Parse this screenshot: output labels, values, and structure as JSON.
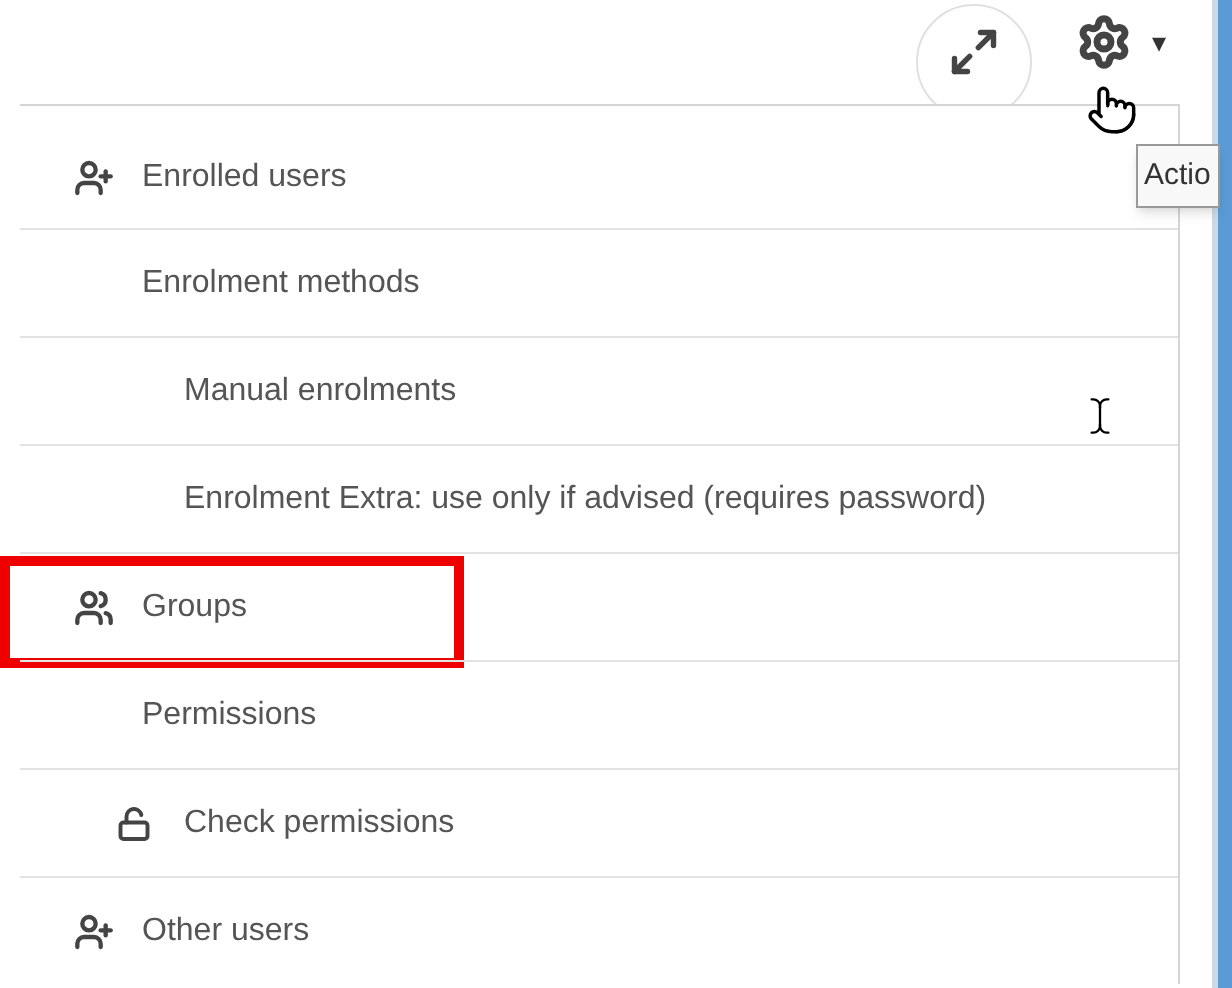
{
  "toolbar": {
    "caret": "▾",
    "tooltip": "Actio"
  },
  "menu": [
    {
      "label": "Enrolled users",
      "kind": "adduser",
      "highlighted": false
    },
    {
      "label": "Enrolment methods",
      "kind": "plain",
      "highlighted": false,
      "children": [
        {
          "label": "Manual enrolments",
          "kind": "plain",
          "highlighted": false
        },
        {
          "label": "Enrolment Extra: use only if advised (requires password)",
          "kind": "plain",
          "highlighted": false
        }
      ]
    },
    {
      "label": "Groups",
      "kind": "group",
      "highlighted": true
    },
    {
      "label": "Permissions",
      "kind": "plain",
      "highlighted": false,
      "children": [
        {
          "label": "Check permissions",
          "kind": "lock",
          "highlighted": false
        }
      ]
    },
    {
      "label": "Other users",
      "kind": "adduser",
      "highlighted": false
    }
  ]
}
